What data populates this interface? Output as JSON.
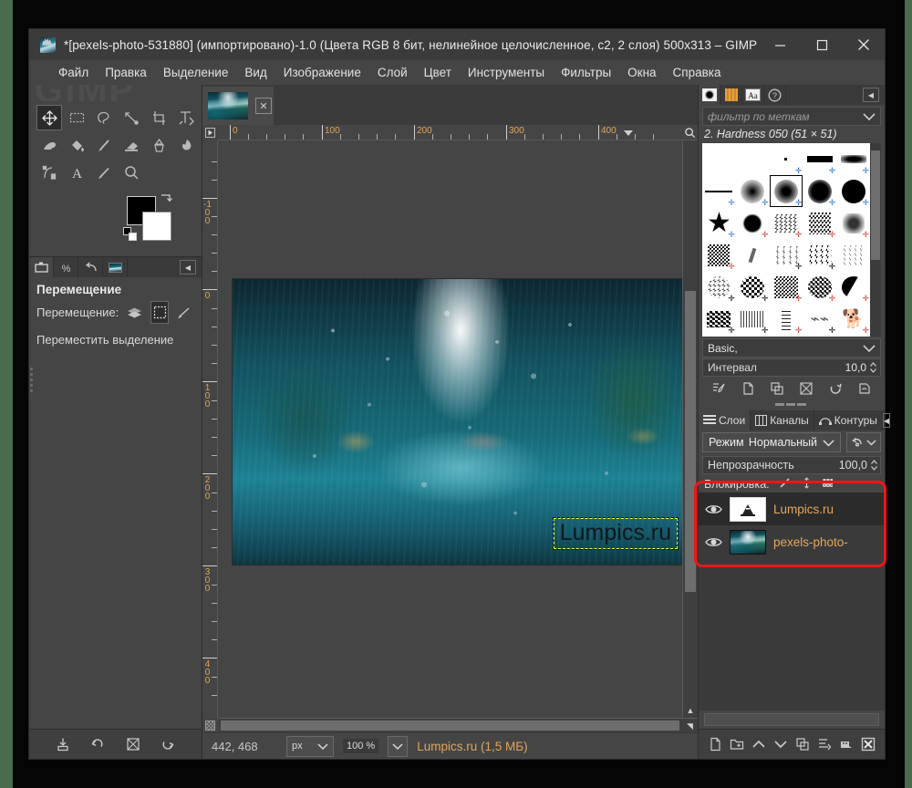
{
  "window": {
    "title": "*[pexels-photo-531880] (импортировано)-1.0 (Цвета RGB 8 бит, нелинейное целочисленное, c2, 2 слоя) 500x313 – GIMP",
    "icon": "image-thumbnail-icon",
    "minimize": "−",
    "maximize": "□",
    "close": "✕"
  },
  "menu": {
    "items": [
      {
        "label": "Файл"
      },
      {
        "label": "Правка"
      },
      {
        "label": "Выделение"
      },
      {
        "label": "Вид"
      },
      {
        "label": "Изображение"
      },
      {
        "label": "Слой"
      },
      {
        "label": "Цвет"
      },
      {
        "label": "Инструменты"
      },
      {
        "label": "Фильтры"
      },
      {
        "label": "Окна"
      },
      {
        "label": "Справка"
      }
    ]
  },
  "toolbox": {
    "tools": [
      {
        "name": "move-tool",
        "active": true
      },
      {
        "name": "rectangle-select-tool",
        "active": false
      },
      {
        "name": "free-select-tool",
        "active": false
      },
      {
        "name": "measure-tool",
        "active": false
      },
      {
        "name": "crop-tool",
        "active": false
      },
      {
        "name": "transform-tool",
        "active": false
      },
      {
        "name": "warp-tool",
        "active": false
      },
      {
        "name": "bucket-fill-tool",
        "active": false
      },
      {
        "name": "paintbrush-tool",
        "active": false
      },
      {
        "name": "eraser-tool",
        "active": false
      },
      {
        "name": "clone-tool",
        "active": false
      },
      {
        "name": "smudge-tool",
        "active": false
      },
      {
        "name": "paths-tool",
        "active": false
      },
      {
        "name": "text-tool",
        "active": false
      },
      {
        "name": "color-picker-tool",
        "active": false
      },
      {
        "name": "zoom-tool",
        "active": false
      }
    ],
    "foreground_color": "#000000",
    "background_color": "#ffffff"
  },
  "tool_options": {
    "dock_tabs": [
      "tool-options-icon",
      "device-status-icon",
      "undo-history-icon",
      "images-icon"
    ],
    "title": "Перемещение",
    "row_label": "Перемещение:",
    "mode_buttons": [
      "move-layer-icon",
      "move-selection-icon",
      "move-path-icon"
    ],
    "active_mode_index": 1,
    "hint": "Переместить выделение"
  },
  "toolbox_bottom_buttons": [
    "save-tool-preset-icon",
    "restore-tool-preset-icon",
    "delete-tool-preset-icon",
    "reset-tool-options-icon"
  ],
  "image_tab": {
    "thumbnail": "image-thumbnail-icon",
    "close": "✕"
  },
  "rulers": {
    "horizontal_labels": [
      "0",
      "100",
      "200",
      "300",
      "400"
    ],
    "vertical_labels": [
      "-100",
      "0",
      "100",
      "200",
      "300",
      "400"
    ],
    "unit_origin_icon": "ruler-origin-icon",
    "zoom_icon": "zoom-image-icon"
  },
  "canvas": {
    "text_layer_value": "Lumpics.ru",
    "selection_border_color": "#ffff30"
  },
  "statusbar": {
    "pointer_position": "442, 468",
    "unit": "px",
    "zoom": "100 %",
    "status_text": "Lumpics.ru (1,5 МБ)",
    "quick_mask_icon": "quick-mask-icon",
    "nav_icon": "navigation-preview-icon"
  },
  "brushes_panel": {
    "tabs": [
      "brushes-icon",
      "patterns-icon",
      "fonts-icon",
      "document-history-icon"
    ],
    "menu_button_icon": "panel-menu-icon",
    "filter_placeholder": "фильтр по меткам",
    "selected_brush": "2. Hardness 050 (51 × 51)",
    "tag_selector_value": "Basic,",
    "spacing_label": "Интервал",
    "spacing_value": "10,0",
    "buttons": [
      "edit-brush-icon",
      "new-brush-icon",
      "duplicate-brush-icon",
      "delete-brush-icon",
      "refresh-brushes-icon",
      "open-brush-as-image-icon"
    ]
  },
  "layers_panel": {
    "tabs": [
      {
        "label": "Слои",
        "icon": "layers-icon",
        "selected": true
      },
      {
        "label": "Каналы",
        "icon": "channels-icon",
        "selected": false
      },
      {
        "label": "Контуры",
        "icon": "paths-icon",
        "selected": false
      }
    ],
    "menu_button_icon": "panel-menu-icon",
    "mode_label": "Режим",
    "mode_value": "Нормальный",
    "mode_switch_icon": "layer-mode-switch-icon",
    "opacity_label": "Непрозрачность",
    "opacity_value": "100,0",
    "lock_label": "Блокировка:",
    "lock_icons": [
      "lock-pixels-icon",
      "lock-position-icon",
      "lock-alpha-icon"
    ],
    "layers": [
      {
        "name": "Lumpics.ru",
        "thumb": "text-layer-thumb",
        "visible": true,
        "selected": true
      },
      {
        "name": "pexels-photo-",
        "thumb": "photo-layer-thumb",
        "visible": true,
        "selected": false
      }
    ],
    "highlight_color": "#f01515",
    "bottom_buttons": [
      "new-layer-icon",
      "new-layer-group-icon",
      "raise-layer-icon",
      "lower-layer-icon",
      "duplicate-layer-icon",
      "anchor-layer-icon",
      "merge-down-icon",
      "delete-layer-icon"
    ]
  }
}
